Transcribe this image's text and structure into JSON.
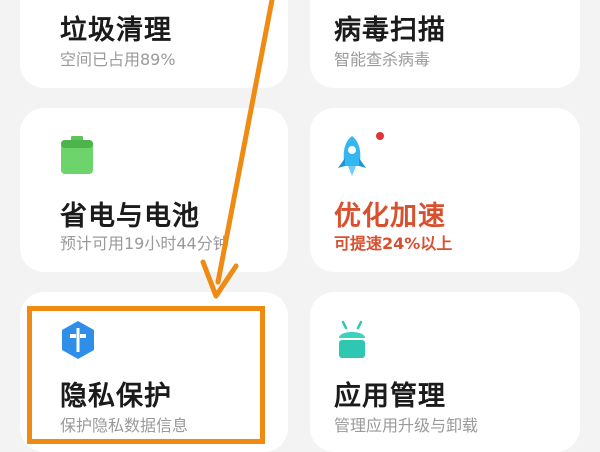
{
  "cards": {
    "junk_clean": {
      "title": "垃圾清理",
      "subtitle": "空间已占用89%"
    },
    "virus_scan": {
      "title": "病毒扫描",
      "subtitle": "智能查杀病毒"
    },
    "battery": {
      "title": "省电与电池",
      "subtitle": "预计可用19小时44分钟"
    },
    "speed_boost": {
      "title": "优化加速",
      "subtitle": "可提速24%以上",
      "accent_color": "#d9502f",
      "has_notification_dot": true
    },
    "privacy": {
      "title": "隐私保护",
      "subtitle": "保护隐私数据信息"
    },
    "app_manage": {
      "title": "应用管理",
      "subtitle": "管理应用升级与卸载"
    }
  },
  "icons": {
    "battery": "battery-icon",
    "speed_boost": "rocket-icon",
    "privacy": "privacy-shield-icon",
    "app_manage": "android-icon"
  },
  "annotation": {
    "highlight_color": "#ef8a12",
    "target": "privacy"
  }
}
